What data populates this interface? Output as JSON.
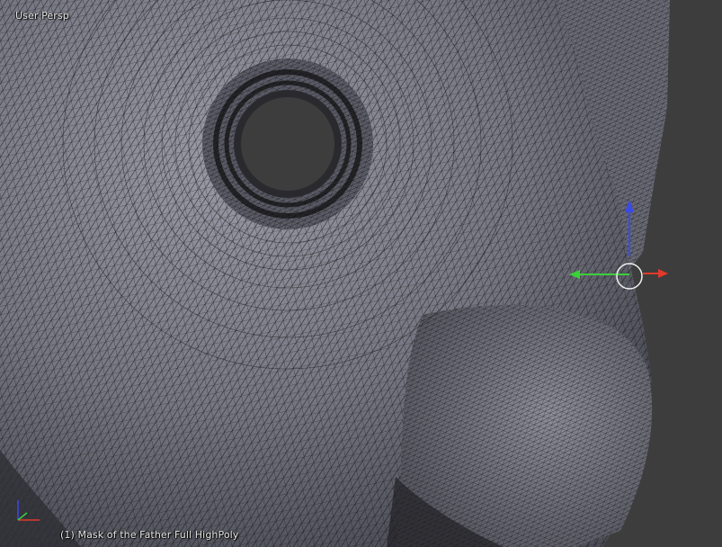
{
  "viewport": {
    "view_label": "User Persp",
    "object_label": "(1) Mask of the Father Full HighPoly",
    "background_color": "#3d3d3d",
    "mesh_color": "#7c7c88",
    "wire_color": "#0a0a0a"
  },
  "icons": {
    "axis_gizmo": "xyz-axis-icon",
    "manipulator": "transform-manipulator-icon"
  },
  "manipulator_colors": {
    "x": "#e23a2a",
    "y": "#3ad13a",
    "z": "#3a4ae8"
  }
}
